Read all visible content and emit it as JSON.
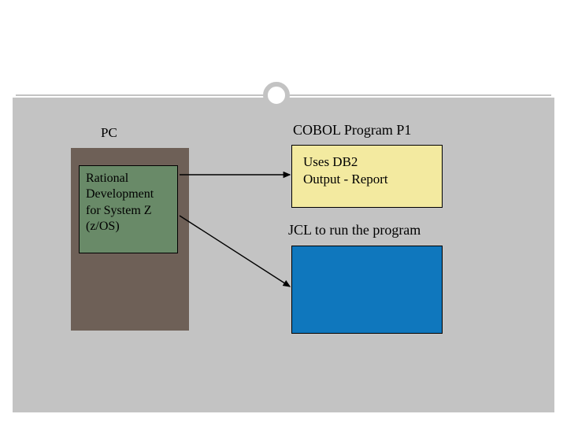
{
  "pc": {
    "label": "PC",
    "rational_text": "Rational Development for System Z (z/OS)"
  },
  "cobol": {
    "title": "COBOL Program P1",
    "body": "Uses DB2\nOutput - Report"
  },
  "jcl": {
    "title": "JCL to run the program"
  }
}
